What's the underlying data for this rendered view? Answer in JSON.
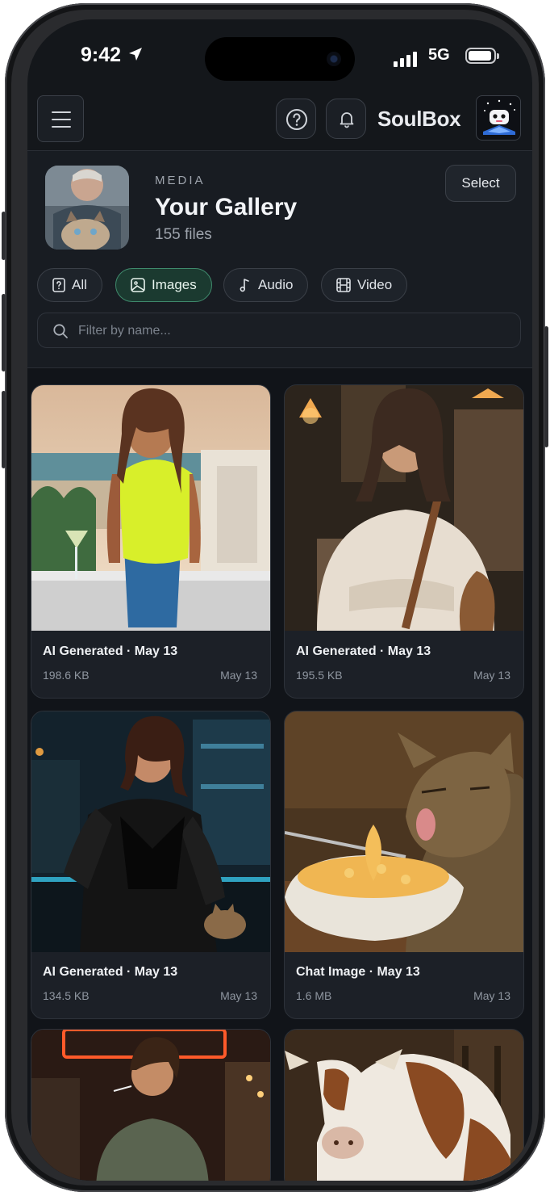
{
  "status_bar": {
    "time": "9:42",
    "network": "5G"
  },
  "topbar": {
    "brand": "SoulBox"
  },
  "header": {
    "kicker": "MEDIA",
    "title": "Your Gallery",
    "count": "155 files",
    "select_label": "Select"
  },
  "filters": [
    {
      "label": "All",
      "icon": "file-question-icon",
      "active": false
    },
    {
      "label": "Images",
      "icon": "image-icon",
      "active": true
    },
    {
      "label": "Audio",
      "icon": "music-note-icon",
      "active": false
    },
    {
      "label": "Video",
      "icon": "film-icon",
      "active": false
    }
  ],
  "search": {
    "placeholder": "Filter by name..."
  },
  "items": [
    {
      "title": "AI Generated · May 13",
      "size": "198.6 KB",
      "date": "May 13",
      "subject": "woman with cocktail on balcony at sunset"
    },
    {
      "title": "AI Generated · May 13",
      "size": "195.5 KB",
      "date": "May 13",
      "subject": "woman in knit sweater in cafe"
    },
    {
      "title": "AI Generated · May 13",
      "size": "134.5 KB",
      "date": "May 13",
      "subject": "woman in leather jacket at bar with cat"
    },
    {
      "title": "Chat Image · May 13",
      "size": "1.6 MB",
      "date": "May 13",
      "subject": "cat eating mac and cheese"
    },
    {
      "title": "",
      "size": "",
      "date": "",
      "subject": "woman in coffee shop with neon sign"
    },
    {
      "title": "",
      "size": "",
      "date": "",
      "subject": "brown and white cow in barn"
    }
  ],
  "colors": {
    "accent": "#3f8a6c",
    "background": "#14171b",
    "card": "#1c2027"
  }
}
